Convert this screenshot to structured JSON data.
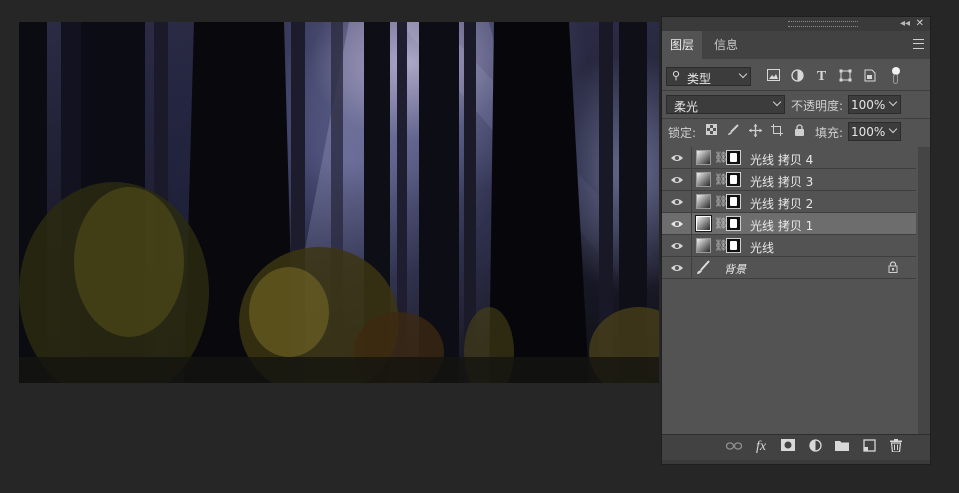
{
  "panel": {
    "tabs": [
      {
        "label": "图层",
        "active": true
      },
      {
        "label": "信息",
        "active": false
      }
    ],
    "filter": {
      "kind_label": "类型"
    },
    "blend_mode": "柔光",
    "opacity_label": "不透明度:",
    "opacity_value": "100%",
    "lock_label": "锁定:",
    "fill_label": "填充:",
    "fill_value": "100%",
    "layers": [
      {
        "name": "光线 拷贝 4",
        "visible": true,
        "selected": false
      },
      {
        "name": "光线 拷贝 3",
        "visible": true,
        "selected": false
      },
      {
        "name": "光线 拷贝 2",
        "visible": true,
        "selected": false
      },
      {
        "name": "光线 拷贝 1",
        "visible": true,
        "selected": true
      },
      {
        "name": "光线",
        "visible": true,
        "selected": false
      },
      {
        "name": "背景",
        "visible": true,
        "selected": false,
        "locked": true
      }
    ],
    "bottom_icons": [
      "link-layers-icon",
      "fx-icon",
      "add-mask-icon",
      "adjustment-layer-icon",
      "group-folder-icon",
      "new-layer-icon",
      "trash-icon"
    ]
  },
  "colors": {
    "workspace": "#262626",
    "panel": "#535353",
    "selected_row": "#6d6d6d"
  }
}
